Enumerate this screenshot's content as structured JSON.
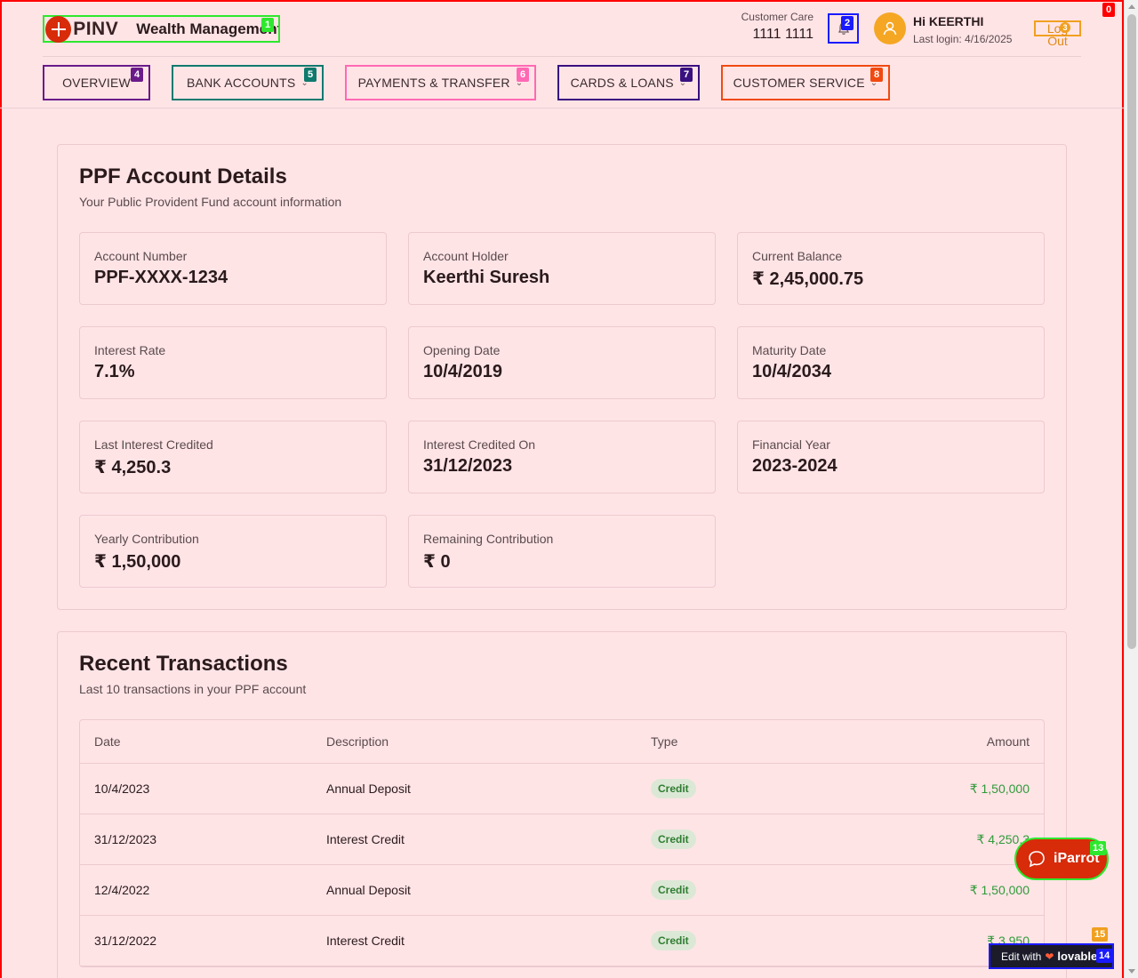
{
  "header": {
    "logo_text": "PINV",
    "logo_sub": "Wealth Management",
    "care_label": "Customer Care",
    "care_number": "1111 1111",
    "user_greet": "Hi KEERTHI",
    "last_login": "Last login: 4/16/2025",
    "logout_label": "Log Out"
  },
  "nav": {
    "items": [
      {
        "label": "OVERVIEW",
        "badge": "4"
      },
      {
        "label": "BANK ACCOUNTS",
        "badge": "5"
      },
      {
        "label": "PAYMENTS & TRANSFER",
        "badge": "6"
      },
      {
        "label": "CARDS & LOANS",
        "badge": "7"
      },
      {
        "label": "CUSTOMER SERVICE",
        "badge": "8"
      }
    ]
  },
  "badges": {
    "page": "0",
    "logo": "1",
    "bell": "2",
    "logout": "3",
    "iparrot": "13",
    "lovable": "14",
    "lovable_top": "15"
  },
  "ppf": {
    "title": "PPF Account Details",
    "subtitle": "Your Public Provident Fund account information",
    "fields": [
      {
        "label": "Account Number",
        "value": "PPF-XXXX-1234"
      },
      {
        "label": "Account Holder",
        "value": "Keerthi Suresh"
      },
      {
        "label": "Current Balance",
        "value": "₹ 2,45,000.75"
      },
      {
        "label": "Interest Rate",
        "value": "7.1%"
      },
      {
        "label": "Opening Date",
        "value": "10/4/2019"
      },
      {
        "label": "Maturity Date",
        "value": "10/4/2034"
      },
      {
        "label": "Last Interest Credited",
        "value": "₹ 4,250.3"
      },
      {
        "label": "Interest Credited On",
        "value": "31/12/2023"
      },
      {
        "label": "Financial Year",
        "value": "2023-2024"
      },
      {
        "label": "Yearly Contribution",
        "value": "₹ 1,50,000"
      },
      {
        "label": "Remaining Contribution",
        "value": "₹ 0"
      }
    ]
  },
  "transactions": {
    "title": "Recent Transactions",
    "subtitle": "Last 10 transactions in your PPF account",
    "columns": [
      "Date",
      "Description",
      "Type",
      "Amount"
    ],
    "rows": [
      {
        "date": "10/4/2023",
        "description": "Annual Deposit",
        "type": "Credit",
        "amount": "₹ 1,50,000"
      },
      {
        "date": "31/12/2023",
        "description": "Interest Credit",
        "type": "Credit",
        "amount": "₹ 4,250.3"
      },
      {
        "date": "12/4/2022",
        "description": "Annual Deposit",
        "type": "Credit",
        "amount": "₹ 1,50,000"
      },
      {
        "date": "31/12/2022",
        "description": "Interest Credit",
        "type": "Credit",
        "amount": "₹ 3,950"
      }
    ]
  },
  "floating": {
    "iparrot_label": "iParrot",
    "lovable_prefix": "Edit with",
    "lovable_brand": "lovable"
  },
  "colors": {
    "background": "#ffe4e6",
    "brand_red": "#d72b0a",
    "credit_green": "#2f9a3a",
    "avatar_orange": "#f5a623"
  }
}
